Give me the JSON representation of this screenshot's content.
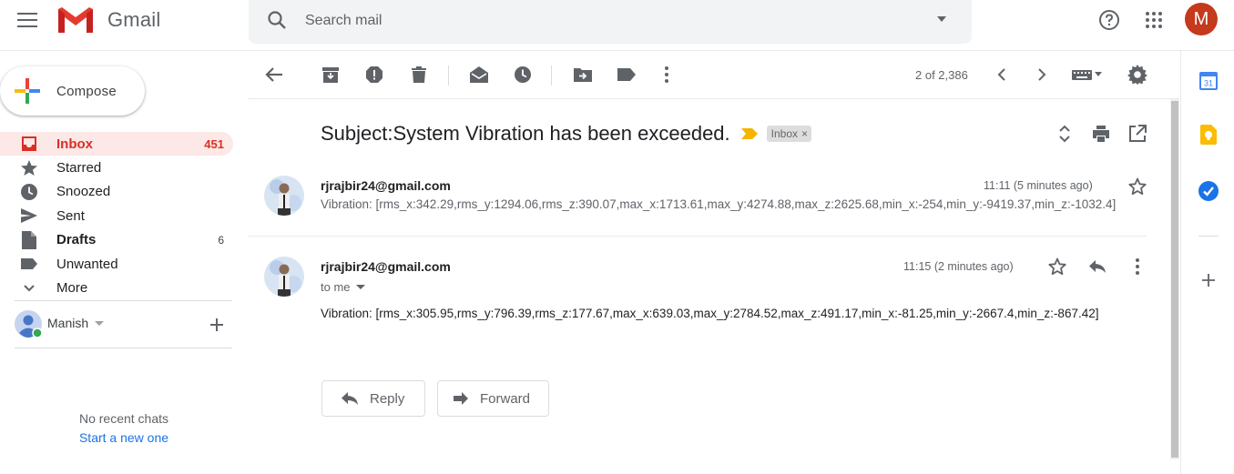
{
  "app": {
    "name": "Gmail",
    "account_initial": "M"
  },
  "search": {
    "placeholder": "Search mail"
  },
  "compose": {
    "label": "Compose"
  },
  "sidebar": {
    "items": [
      {
        "label": "Inbox",
        "count": "451",
        "icon": "inbox-icon",
        "active": true
      },
      {
        "label": "Starred",
        "count": "",
        "icon": "star-icon"
      },
      {
        "label": "Snoozed",
        "count": "",
        "icon": "clock-icon"
      },
      {
        "label": "Sent",
        "count": "",
        "icon": "send-icon"
      },
      {
        "label": "Drafts",
        "count": "6",
        "icon": "draft-icon"
      },
      {
        "label": "Unwanted",
        "count": "",
        "icon": "label-icon"
      },
      {
        "label": "More",
        "count": "",
        "icon": "chevron-down-icon"
      }
    ]
  },
  "hangouts": {
    "user_name": "Manish",
    "status_color": "#34a853",
    "no_recent_chats": "No recent chats",
    "start_new": "Start a new one"
  },
  "toolbar": {
    "pager": "2 of 2,386"
  },
  "thread": {
    "subject": "Subject:System Vibration has been exceeded.",
    "label_chip": "Inbox",
    "label_chip_close": "×",
    "messages": [
      {
        "sender": "rjrajbir24@gmail.com",
        "time": "11:11 (5 minutes ago)",
        "snippet": "Vibration: [rms_x:342.29,rms_y:1294.06,rms_z:390.07,max_x:1713.61,max_y:4274.88,max_z:2625.68,min_x:-254,min_y:-9419.37,min_z:-1032.4]"
      },
      {
        "sender": "rjrajbir24@gmail.com",
        "time": "11:15 (2 minutes ago)",
        "recipient": "to me",
        "body": "Vibration: [rms_x:305.95,rms_y:796.39,rms_z:177.67,max_x:639.03,max_y:2784.52,max_z:491.17,min_x:-81.25,min_y:-2667.4,min_z:-867.42]"
      }
    ],
    "reply_label": "Reply",
    "forward_label": "Forward"
  },
  "colors": {
    "accent_red": "#d93025",
    "active_bg": "#fce8e6",
    "avatar_bg": "#c5391d",
    "link_blue": "#1a73e8",
    "important_marker": "#f4b400"
  }
}
